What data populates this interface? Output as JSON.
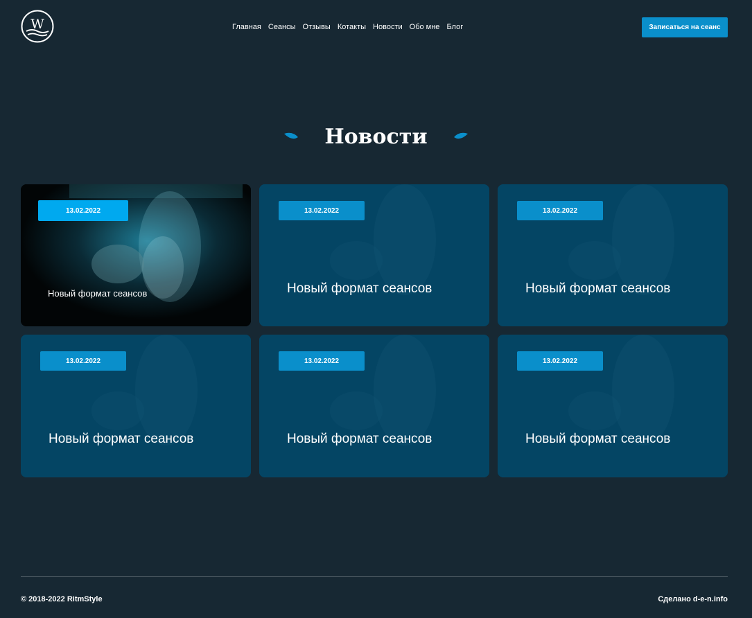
{
  "header": {
    "logo_letter": "W",
    "nav": [
      "Главная",
      "Сеансы",
      "Отзывы",
      "Котакты",
      "Новости",
      "Обо мне",
      "Блог"
    ],
    "cta_label": "Записаться на сеанс"
  },
  "section": {
    "title": "Новости"
  },
  "colors": {
    "background": "#172833",
    "accent": "#0a8fcb",
    "card": "#0b4766"
  },
  "cards": [
    {
      "date": "13.02.2022",
      "title": "Новый формат сеансов",
      "state": "active"
    },
    {
      "date": "13.02.2022",
      "title": "Новый формат сеансов"
    },
    {
      "date": "13.02.2022",
      "title": "Новый формат сеансов"
    },
    {
      "date": "13.02.2022",
      "title": "Новый формат сеансов"
    },
    {
      "date": "13.02.2022",
      "title": "Новый формат сеансов"
    },
    {
      "date": "13.02.2022",
      "title": "Новый формат сеансов"
    }
  ],
  "footer": {
    "copyright": "© 2018-2022 RitmStyle",
    "made_by": "Сделано d-e-n.info"
  }
}
